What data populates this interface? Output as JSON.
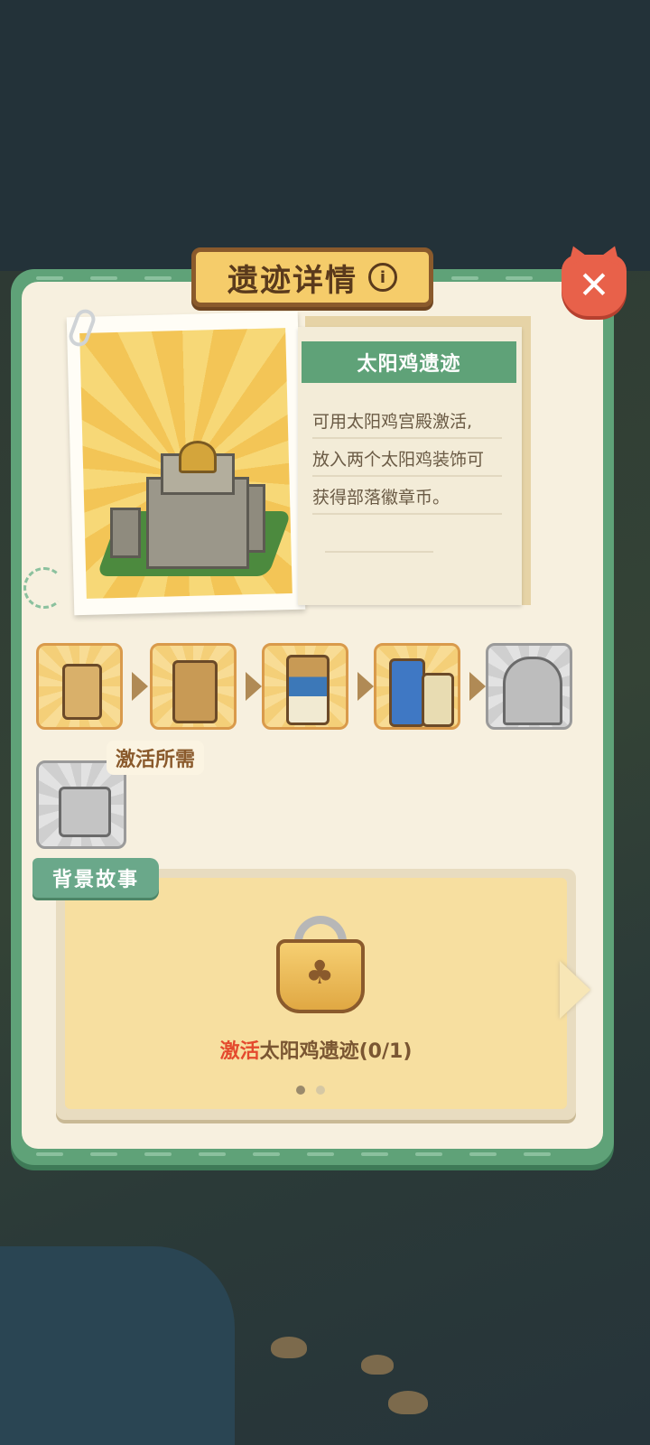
{
  "dialog": {
    "title": "遗迹详情",
    "close_label": "✕"
  },
  "ruin": {
    "name": "太阳鸡遗迹",
    "description_lines": [
      "可用太阳鸡宫殿激活,",
      "放入两个太阳鸡装饰可",
      "获得部落徽章币。"
    ]
  },
  "requirements": {
    "label": "激活所需"
  },
  "story": {
    "tab_label": "背景故事",
    "status_prefix": "激活",
    "status_rest": "太阳鸡遗迹(0/1)",
    "page_dots": 2,
    "active_dot": 0
  },
  "colors": {
    "panel_green": "#5fa278",
    "title_gold": "#f5cc6a",
    "close_red": "#e8614a",
    "highlight_red": "#e44a2e"
  }
}
